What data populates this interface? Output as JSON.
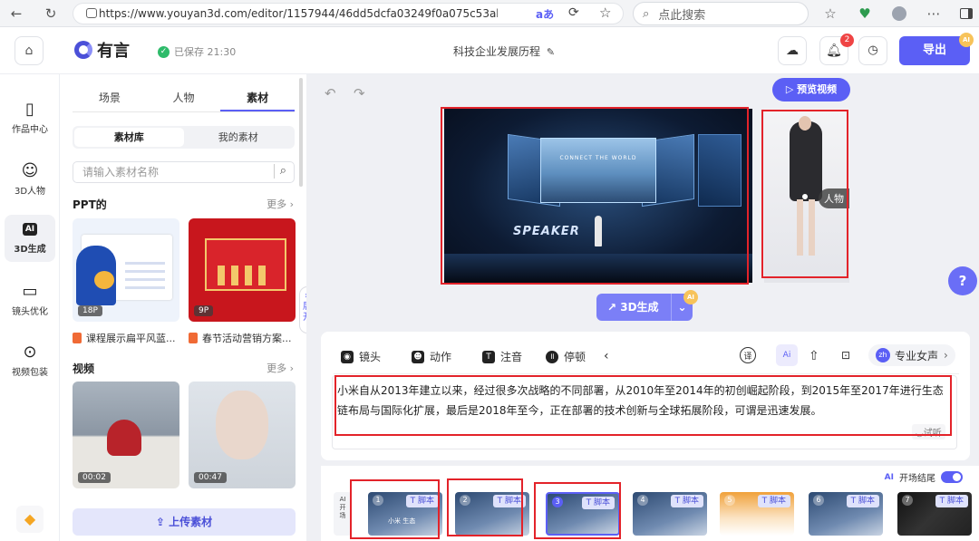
{
  "browser": {
    "url": "https://www.youyan3d.com/editor/1157944/46dd5dcfa03249f0a075c53ab42a33e1?t...",
    "search_placeholder": "点此搜索"
  },
  "header": {
    "logo": "有言",
    "save_status": "已保存 21:30",
    "doc_title": "科技企业发展历程",
    "notification_count": "2",
    "export_label": "导出",
    "ai_badge": "AI"
  },
  "nav": {
    "items": [
      {
        "label": "作品中心",
        "icon": "frame-icon"
      },
      {
        "label": "3D人物",
        "icon": "person-icon"
      },
      {
        "label": "3D生成",
        "icon": "ai-icon"
      },
      {
        "label": "镜头优化",
        "icon": "camera-icon"
      },
      {
        "label": "视频包装",
        "icon": "package-icon"
      }
    ]
  },
  "panel": {
    "tabs": [
      "场景",
      "人物",
      "素材"
    ],
    "segments": [
      "素材库",
      "我的素材"
    ],
    "search_placeholder": "请输入素材名称",
    "ppt_title": "PPT的",
    "video_title": "视频",
    "more": "更多",
    "ppt_items": [
      {
        "badge": "18P",
        "caption": "课程展示扁平风蓝..."
      },
      {
        "badge": "9P",
        "caption": "春节活动营销方案..."
      }
    ],
    "video_items": [
      {
        "badge": "00:02"
      },
      {
        "badge": "00:47"
      }
    ],
    "upload_label": "上传素材",
    "expand_label": "展开"
  },
  "stage": {
    "preview_label": "预览视频",
    "scene_text_top": "CONNECT THE WORLD",
    "scene_text_speaker": "SPEAKER",
    "person_tag": "人物",
    "generate_label": "3D生成",
    "generate_badge": "AI"
  },
  "editor": {
    "tools": [
      "镜头",
      "动作",
      "注音",
      "停顿"
    ],
    "voice_label": "专业女声",
    "voice_lang": "zh",
    "script_text": "小米自从2013年建立以来，经过很多次战略的不同部署，从2010年至2014年的初创崛起阶段，到2015年至2017年进行生态链布局与国际化扩展，最后是2018年至今，正在部署的技术创新与全球拓展阶段，可谓是迅速发展。",
    "audition_label": "试听"
  },
  "timeline": {
    "ai_label": "AI",
    "opening_label": "开场结尾",
    "ai_opening": "AI开场",
    "script_tag": "脚本",
    "frames": [
      "1",
      "2",
      "3",
      "4",
      "5",
      "6",
      "7"
    ],
    "frame1_caption": "小米 生态"
  },
  "help_label": "?"
}
